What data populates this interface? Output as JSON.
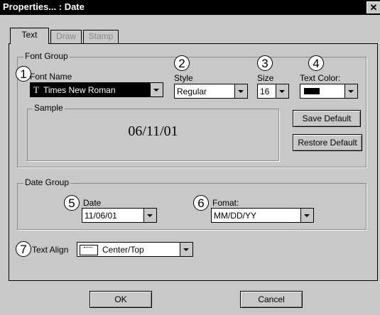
{
  "window": {
    "title": "Properties... : Date",
    "close_glyph": "✕"
  },
  "tabs": [
    {
      "label": "Text",
      "active": true
    },
    {
      "label": "Draw",
      "active": false
    },
    {
      "label": "Stamp",
      "active": false
    }
  ],
  "font_group": {
    "label": "Font Group",
    "font_name": {
      "label": "Font Name",
      "value": "Times New Roman",
      "icon": "truetype-icon",
      "icon_glyph": "T"
    },
    "style": {
      "label": "Style",
      "value": "Regular"
    },
    "size": {
      "label": "Size",
      "value": "16"
    },
    "text_color": {
      "label": "Text Color:",
      "value": "#000000"
    },
    "sample": {
      "label": "Sample",
      "text": "06/11/01"
    },
    "save_default_label": "Save Default",
    "restore_default_label": "Restore Default"
  },
  "date_group": {
    "label": "Date Group",
    "date": {
      "label": "Date",
      "value": "11/06/01"
    },
    "format": {
      "label": "Fomat:",
      "value": "MM/DD/YY"
    }
  },
  "text_align": {
    "label": "Text Align",
    "value": "Center/Top"
  },
  "footer": {
    "ok_label": "OK",
    "cancel_label": "Cancel"
  },
  "callouts": [
    "1",
    "2",
    "3",
    "4",
    "5",
    "6",
    "7"
  ],
  "colors": {
    "dialog_bg": "#c8c8c8",
    "titlebar_bg": "#000000",
    "selection_bg": "#000000"
  }
}
